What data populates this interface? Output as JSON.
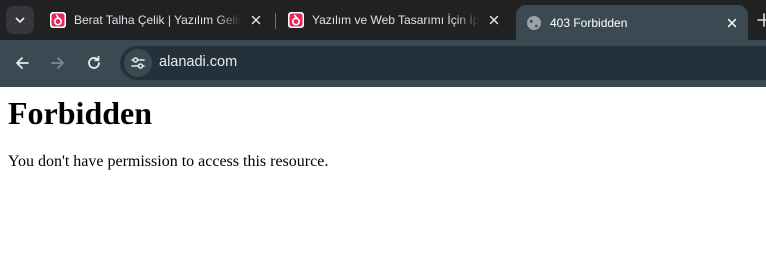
{
  "browser": {
    "tabs": [
      {
        "title": "Berat Talha Çelik | Yazılım Geliştirici",
        "favicon": "site-logo-icon",
        "active": false
      },
      {
        "title": "Yazılım ve Web Tasarımı İçin İpuçları",
        "favicon": "site-logo-icon",
        "active": false
      },
      {
        "title": "403 Forbidden",
        "favicon": "globe-icon",
        "active": true
      }
    ],
    "address_bar": {
      "url": "alanadi.com"
    },
    "colors": {
      "tab_strip": "#1f2123",
      "toolbar": "#3b4a52",
      "omnibox": "#24313a",
      "favicon_accent": "#e8265e"
    }
  },
  "page": {
    "heading": "Forbidden",
    "message": "You don't have permission to access this resource."
  }
}
